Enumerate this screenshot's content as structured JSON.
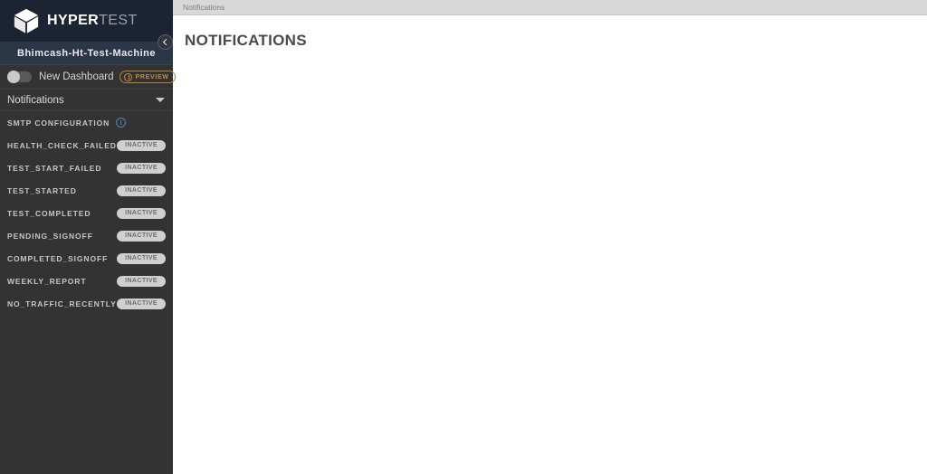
{
  "brand": {
    "name_bold": "HYPER",
    "name_light": "TEST",
    "logo_icon": "cube-icon"
  },
  "sidebar": {
    "machine_name": "Bhimcash-Ht-Test-Machine",
    "collapse_icon": "chevron-left-icon",
    "new_dashboard": {
      "label": "New Dashboard",
      "toggle_state": "off",
      "badge_label": "PREVIEW",
      "badge_icon": "info-circle-icon",
      "badge_color": "#c08f45"
    },
    "section": {
      "label": "Notifications",
      "caret_icon": "chevron-down-icon",
      "expanded": true
    },
    "smtp": {
      "label": "SMTP CONFIGURATION",
      "info_icon": "info-circle-icon",
      "info_color": "#4a7fc1"
    },
    "notifications": [
      {
        "label": "HEALTH_CHECK_FAILED",
        "status": "INACTIVE"
      },
      {
        "label": "TEST_START_FAILED",
        "status": "INACTIVE"
      },
      {
        "label": "TEST_STARTED",
        "status": "INACTIVE"
      },
      {
        "label": "TEST_COMPLETED",
        "status": "INACTIVE"
      },
      {
        "label": "PENDING_SIGNOFF",
        "status": "INACTIVE"
      },
      {
        "label": "COMPLETED_SIGNOFF",
        "status": "INACTIVE"
      },
      {
        "label": "WEEKLY_REPORT",
        "status": "INACTIVE"
      },
      {
        "label": "NO_TRAFFIC_RECENTLY",
        "status": "INACTIVE"
      }
    ]
  },
  "main": {
    "breadcrumb": "Notifications",
    "page_title": "NOTIFICATIONS"
  },
  "colors": {
    "sidebar_bg": "#333333",
    "logo_bg": "#1c2433",
    "machine_bg": "#2b3647",
    "breadcrumb_bg": "#d8d8d8",
    "pill_bg": "#cfcfcf",
    "accent_orange": "#c08f45",
    "accent_blue": "#4a7fc1"
  }
}
